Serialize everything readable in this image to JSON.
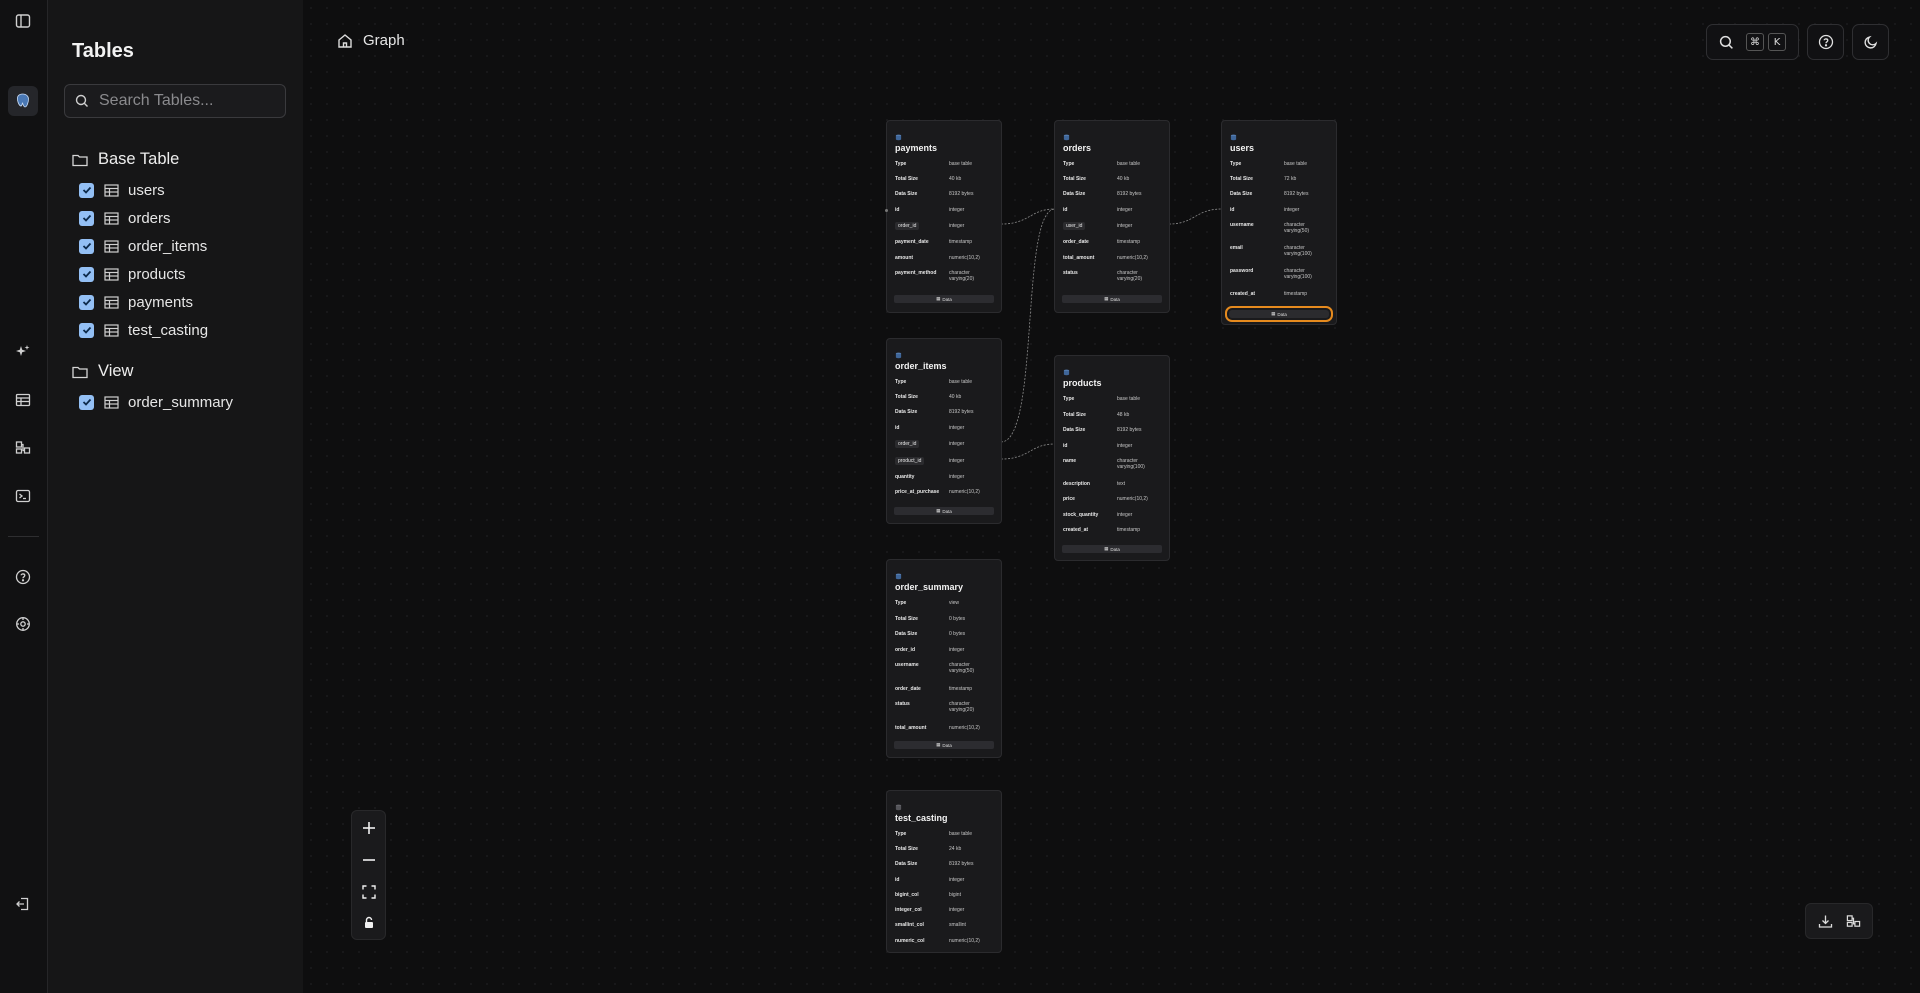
{
  "sidebar": {
    "title": "Tables",
    "search_placeholder": "Search Tables...",
    "groups": [
      {
        "label": "Base Table",
        "items": [
          "users",
          "orders",
          "order_items",
          "products",
          "payments",
          "test_casting"
        ]
      },
      {
        "label": "View",
        "items": [
          "order_summary"
        ]
      }
    ]
  },
  "header": {
    "breadcrumb": "Graph",
    "shortcut_keys": [
      "⌘",
      "K"
    ]
  },
  "tables": {
    "payments": {
      "name": "payments",
      "data_label": "Data",
      "rows": [
        {
          "k": "Type",
          "v": "base table"
        },
        {
          "k": "Total Size",
          "v": "40 kb"
        },
        {
          "k": "Data Size",
          "v": "8192 bytes"
        },
        {
          "k": "id",
          "v": "integer"
        },
        {
          "k": "order_id",
          "v": "integer"
        },
        {
          "k": "payment_date",
          "v": "timestamp"
        },
        {
          "k": "amount",
          "v": "numeric(10,2)"
        },
        {
          "k": "payment_method",
          "v": "character varying(20)"
        }
      ]
    },
    "orders": {
      "name": "orders",
      "data_label": "Data",
      "rows": [
        {
          "k": "Type",
          "v": "base table"
        },
        {
          "k": "Total Size",
          "v": "40 kb"
        },
        {
          "k": "Data Size",
          "v": "8192 bytes"
        },
        {
          "k": "id",
          "v": "integer"
        },
        {
          "k": "user_id",
          "v": "integer"
        },
        {
          "k": "order_date",
          "v": "timestamp"
        },
        {
          "k": "total_amount",
          "v": "numeric(10,2)"
        },
        {
          "k": "status",
          "v": "character varying(20)"
        }
      ]
    },
    "users": {
      "name": "users",
      "data_label": "Data",
      "rows": [
        {
          "k": "Type",
          "v": "base table"
        },
        {
          "k": "Total Size",
          "v": "72 kb"
        },
        {
          "k": "Data Size",
          "v": "8192 bytes"
        },
        {
          "k": "id",
          "v": "integer"
        },
        {
          "k": "username",
          "v": "character varying(50)"
        },
        {
          "k": "email",
          "v": "character varying(100)"
        },
        {
          "k": "password",
          "v": "character varying(100)"
        },
        {
          "k": "created_at",
          "v": "timestamp"
        }
      ]
    },
    "order_items": {
      "name": "order_items",
      "data_label": "Data",
      "rows": [
        {
          "k": "Type",
          "v": "base table"
        },
        {
          "k": "Total Size",
          "v": "40 kb"
        },
        {
          "k": "Data Size",
          "v": "8192 bytes"
        },
        {
          "k": "id",
          "v": "integer"
        },
        {
          "k": "order_id",
          "v": "integer"
        },
        {
          "k": "product_id",
          "v": "integer"
        },
        {
          "k": "quantity",
          "v": "integer"
        },
        {
          "k": "price_at_purchase",
          "v": "numeric(10,2)"
        }
      ]
    },
    "products": {
      "name": "products",
      "data_label": "Data",
      "rows": [
        {
          "k": "Type",
          "v": "base table"
        },
        {
          "k": "Total Size",
          "v": "48 kb"
        },
        {
          "k": "Data Size",
          "v": "8192 bytes"
        },
        {
          "k": "id",
          "v": "integer"
        },
        {
          "k": "name",
          "v": "character varying(100)"
        },
        {
          "k": "description",
          "v": "text"
        },
        {
          "k": "price",
          "v": "numeric(10,2)"
        },
        {
          "k": "stock_quantity",
          "v": "integer"
        },
        {
          "k": "created_at",
          "v": "timestamp"
        }
      ]
    },
    "order_summary": {
      "name": "order_summary",
      "data_label": "Data",
      "rows": [
        {
          "k": "Type",
          "v": "view"
        },
        {
          "k": "Total Size",
          "v": "0 bytes"
        },
        {
          "k": "Data Size",
          "v": "0 bytes"
        },
        {
          "k": "order_id",
          "v": "integer"
        },
        {
          "k": "username",
          "v": "character varying(50)"
        },
        {
          "k": "order_date",
          "v": "timestamp"
        },
        {
          "k": "status",
          "v": "character varying(20)"
        },
        {
          "k": "total_amount",
          "v": "numeric(10,2)"
        }
      ]
    },
    "test_casting": {
      "name": "test_casting",
      "rows": [
        {
          "k": "Type",
          "v": "base table"
        },
        {
          "k": "Total Size",
          "v": "24 kb"
        },
        {
          "k": "Data Size",
          "v": "8192 bytes"
        },
        {
          "k": "id",
          "v": "integer"
        },
        {
          "k": "bigint_col",
          "v": "bigint"
        },
        {
          "k": "integer_col",
          "v": "integer"
        },
        {
          "k": "smallint_col",
          "v": "smallint"
        },
        {
          "k": "numeric_col",
          "v": "numeric(10,2)"
        }
      ]
    }
  },
  "colors": {
    "accent_checkbox": "#93bff4",
    "highlight_outline": "#e58a1e",
    "background": "#0e0e0f"
  }
}
